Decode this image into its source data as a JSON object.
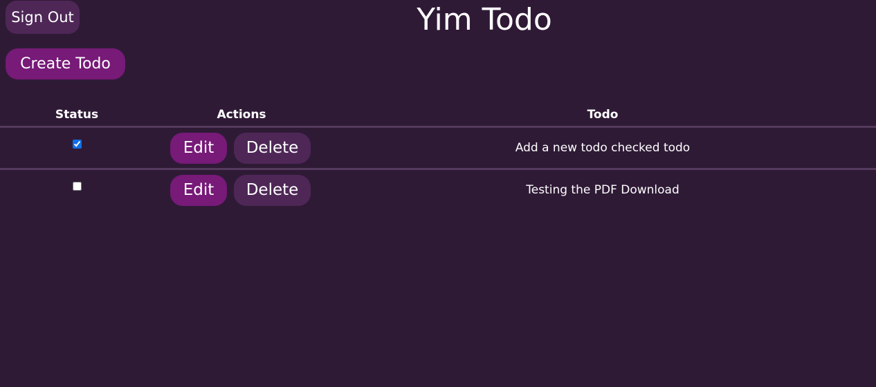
{
  "header": {
    "sign_out_label": "Sign Out",
    "title": "Yim Todo",
    "create_label": "Create Todo"
  },
  "table": {
    "columns": [
      "Status",
      "Actions",
      "Todo"
    ],
    "rows": [
      {
        "checked": true,
        "edit_label": "Edit",
        "delete_label": "Delete",
        "text": "Add a new todo checked todo"
      },
      {
        "checked": false,
        "edit_label": "Edit",
        "delete_label": "Delete",
        "text": "Testing the PDF Download"
      }
    ]
  },
  "colors": {
    "background": "#2f1a36",
    "primary_button": "#771a78",
    "secondary_button": "#4e2757",
    "divider": "#543a5c"
  }
}
